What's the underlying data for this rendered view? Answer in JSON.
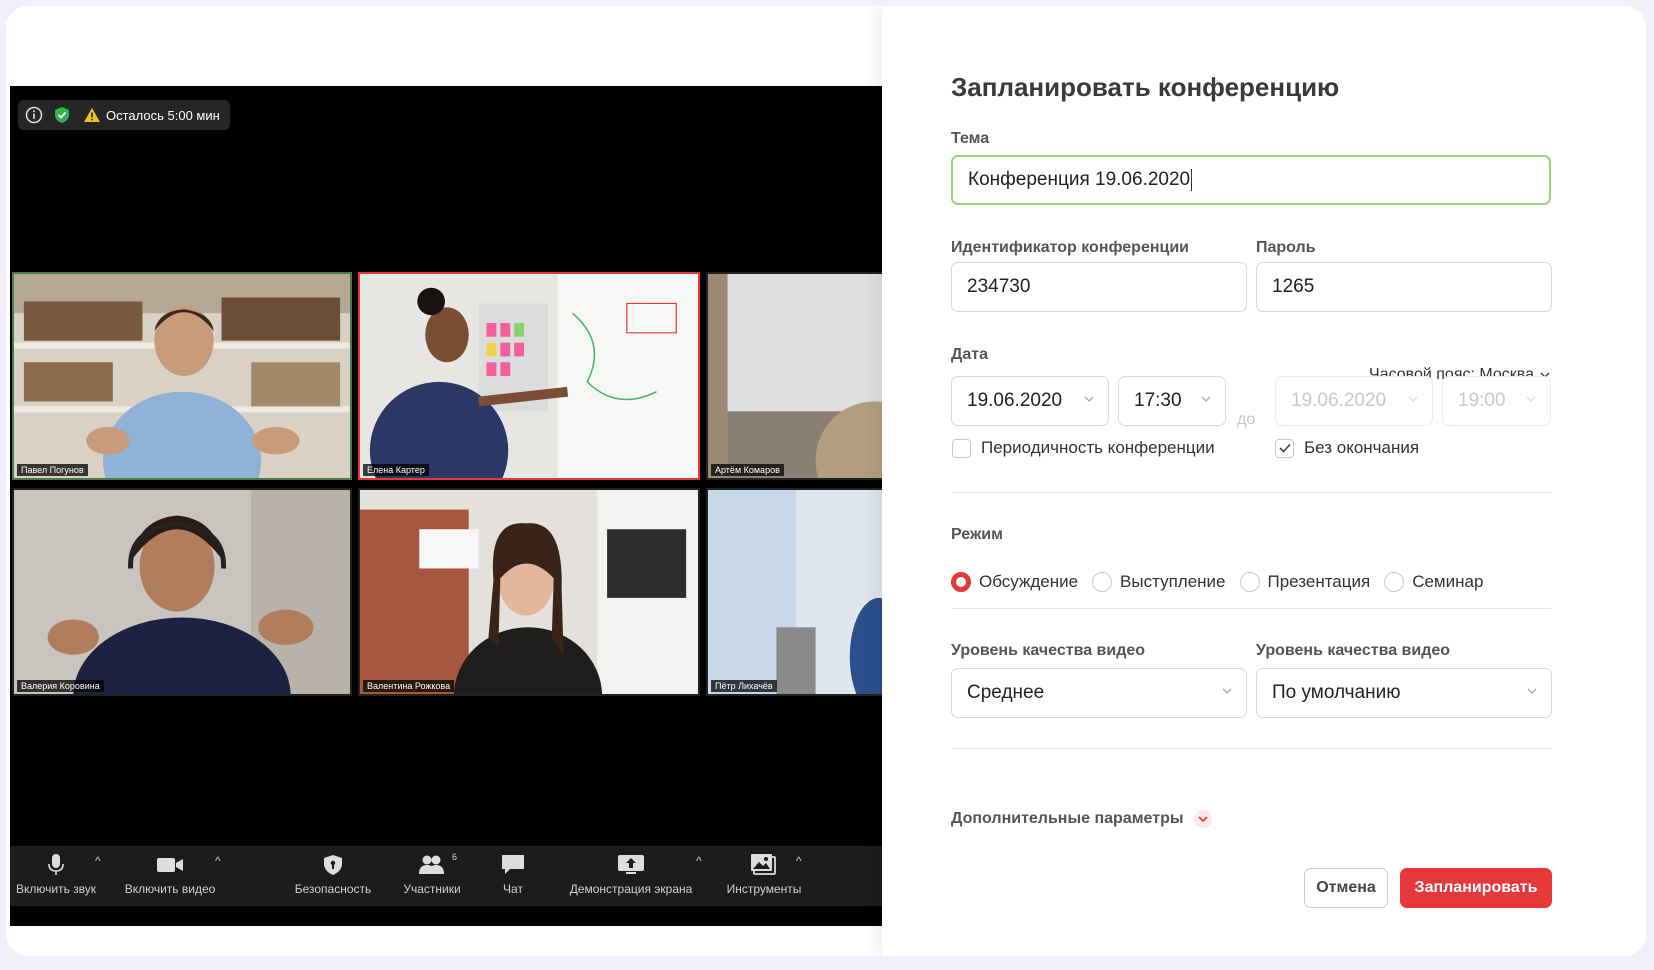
{
  "meeting": {
    "status": {
      "timer_text": "Осталось 5:00 мин"
    },
    "participants": [
      {
        "name": "Павел Погунов"
      },
      {
        "name": "Елена Картер"
      },
      {
        "name": "Артём Комаров"
      },
      {
        "name": "Валерия Коровина"
      },
      {
        "name": "Валентина Рожкова"
      },
      {
        "name": "Пётр Лихачёв"
      }
    ],
    "toolbar": {
      "audio": "Включить звук",
      "video": "Включить видео",
      "security": "Безопасность",
      "participants": "Участники",
      "participants_count": "6",
      "chat": "Чат",
      "share": "Демонстрация экрана",
      "tools": "Инструменты"
    }
  },
  "form": {
    "title": "Запланировать конференцию",
    "topic_label": "Тема",
    "topic_value": "Конференция 19.06.2020",
    "id_label": "Идентификатор конференции",
    "id_value": "234730",
    "password_label": "Пароль",
    "password_value": "1265",
    "date_label": "Дата",
    "timezone": "Часовой пояс: Москва",
    "start_date": "19.06.2020",
    "start_time": "17:30",
    "to_label": "до",
    "end_date": "19.06.2020",
    "end_time": "19:00",
    "recurring_label": "Периодичность конференции",
    "recurring_checked": false,
    "no_end_label": "Без окончания",
    "no_end_checked": true,
    "mode_label": "Режим",
    "modes": [
      "Обсуждение",
      "Выступление",
      "Презентация",
      "Семинар"
    ],
    "mode_selected": "Обсуждение",
    "video_quality_label_1": "Уровень качества видео",
    "video_quality_value_1": "Среднее",
    "video_quality_label_2": "Уровень качества видео",
    "video_quality_value_2": "По умолчанию",
    "advanced_label": "Дополнительные параметры",
    "cancel_label": "Отмена",
    "submit_label": "Запланировать"
  },
  "colors": {
    "accent": "#e5383b",
    "focus_border": "#93d57f",
    "background": "#f3effa"
  }
}
